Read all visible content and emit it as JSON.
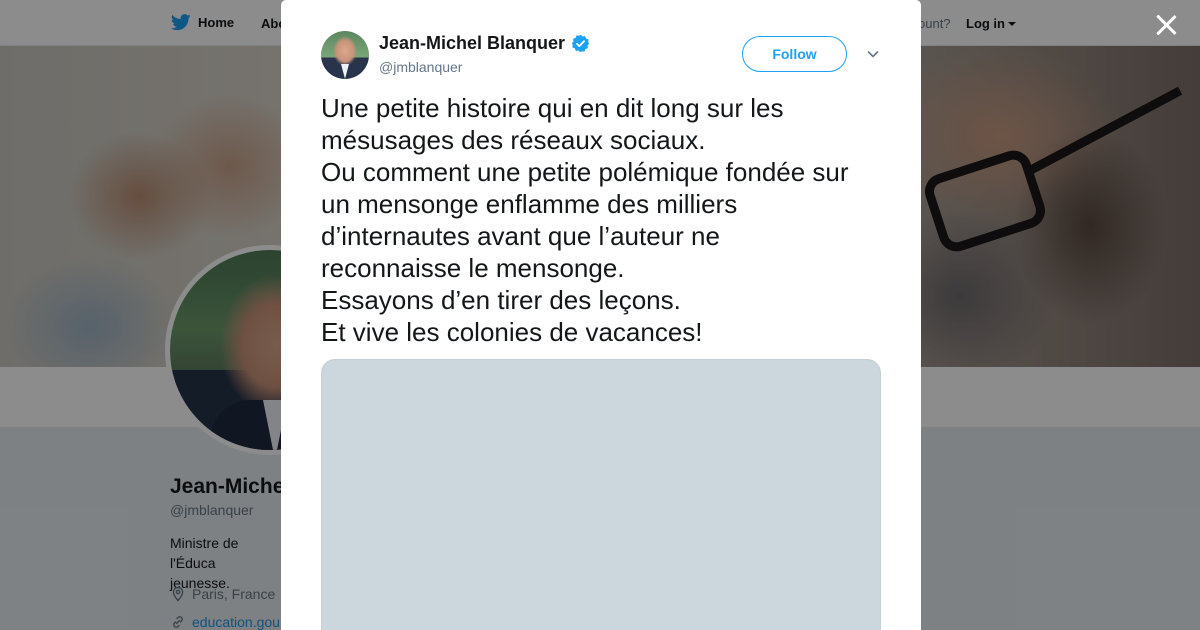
{
  "background_page": {
    "nav": {
      "home_label": "Home",
      "about_label_partial": "Abo",
      "account_text_partial": "ccount?",
      "login_label": "Log in"
    },
    "profile": {
      "name_partial": "Jean-Miche",
      "handle": "@jmblanquer",
      "bio_partial_line1": "Ministre de l'Éduca",
      "bio_partial_line2": "jeunesse.",
      "location": "Paris, France",
      "url_partial": "education.gou"
    }
  },
  "modal": {
    "author": {
      "name": "Jean-Michel Blanquer",
      "handle": "@jmblanquer",
      "verified": true
    },
    "follow_label": "Follow",
    "tweet_lines": [
      "Une petite histoire qui en dit long sur les",
      "mésusages des réseaux sociaux.",
      "Ou comment une petite polémique fondée sur",
      "un mensonge enflamme des milliers",
      "d’internautes avant que l’auteur ne",
      "reconnaisse le mensonge.",
      "Essayons d’en tirer des leçons.",
      "Et vive les colonies de vacances!"
    ]
  },
  "colors": {
    "accent": "#1da1f2",
    "text": "#14171a",
    "muted": "#657786",
    "media_placeholder": "#ccd6dd"
  },
  "icons": [
    "twitter-bird-icon",
    "close-icon",
    "verified-badge-icon",
    "chevron-down-icon",
    "location-pin-icon",
    "link-icon"
  ]
}
